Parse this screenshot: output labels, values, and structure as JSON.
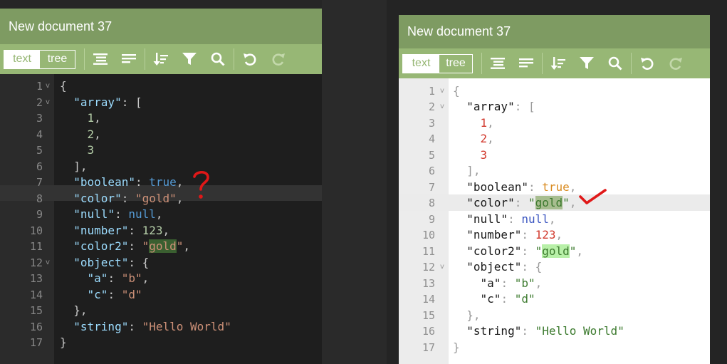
{
  "left": {
    "title": "New document 37",
    "tabs": [
      "text",
      "tree"
    ],
    "toolbar_icons": [
      "format-icon",
      "compact-icon",
      "sort-icon",
      "filter-icon",
      "search-icon",
      "undo-icon",
      "redo-icon"
    ],
    "line_numbers": [
      "1",
      "2",
      "3",
      "4",
      "5",
      "6",
      "7",
      "8",
      "9",
      "10",
      "11",
      "12",
      "13",
      "14",
      "15",
      "16",
      "17"
    ],
    "annotation": "?",
    "colors": {
      "title": "#7e9b62",
      "toolbar": "#97b775",
      "editor_bg": "#1e1e1e",
      "gutter_bg": "#2b2b2b"
    }
  },
  "right": {
    "title": "New document 37",
    "tabs": [
      "text",
      "tree"
    ],
    "toolbar_icons": [
      "format-icon",
      "compact-icon",
      "sort-icon",
      "filter-icon",
      "search-icon",
      "undo-icon",
      "redo-icon"
    ],
    "line_numbers": [
      "1",
      "2",
      "3",
      "4",
      "5",
      "6",
      "7",
      "8",
      "9",
      "10",
      "11",
      "12",
      "13",
      "14",
      "15",
      "16",
      "17"
    ],
    "annotation": "checkmark",
    "colors": {
      "title": "#7e9b62",
      "toolbar": "#97b775",
      "editor_bg": "#ffffff",
      "gutter_bg": "#ececec"
    }
  },
  "code": {
    "l1": "{",
    "array_key": "\"array\"",
    "v1": "1",
    "v2": "2",
    "v3": "3",
    "boolean_key": "\"boolean\"",
    "boolean_val": "true",
    "color_key": "\"color\"",
    "gold": "gold",
    "null_key": "\"null\"",
    "null_val": "null",
    "number_key": "\"number\"",
    "number_val": "123",
    "color2_key": "\"color2\"",
    "object_key": "\"object\"",
    "a_key": "\"a\"",
    "a_val": "\"b\"",
    "c_key": "\"c\"",
    "c_val": "\"d\"",
    "string_key": "\"string\"",
    "string_val": "\"Hello World\"",
    "close": "}"
  }
}
